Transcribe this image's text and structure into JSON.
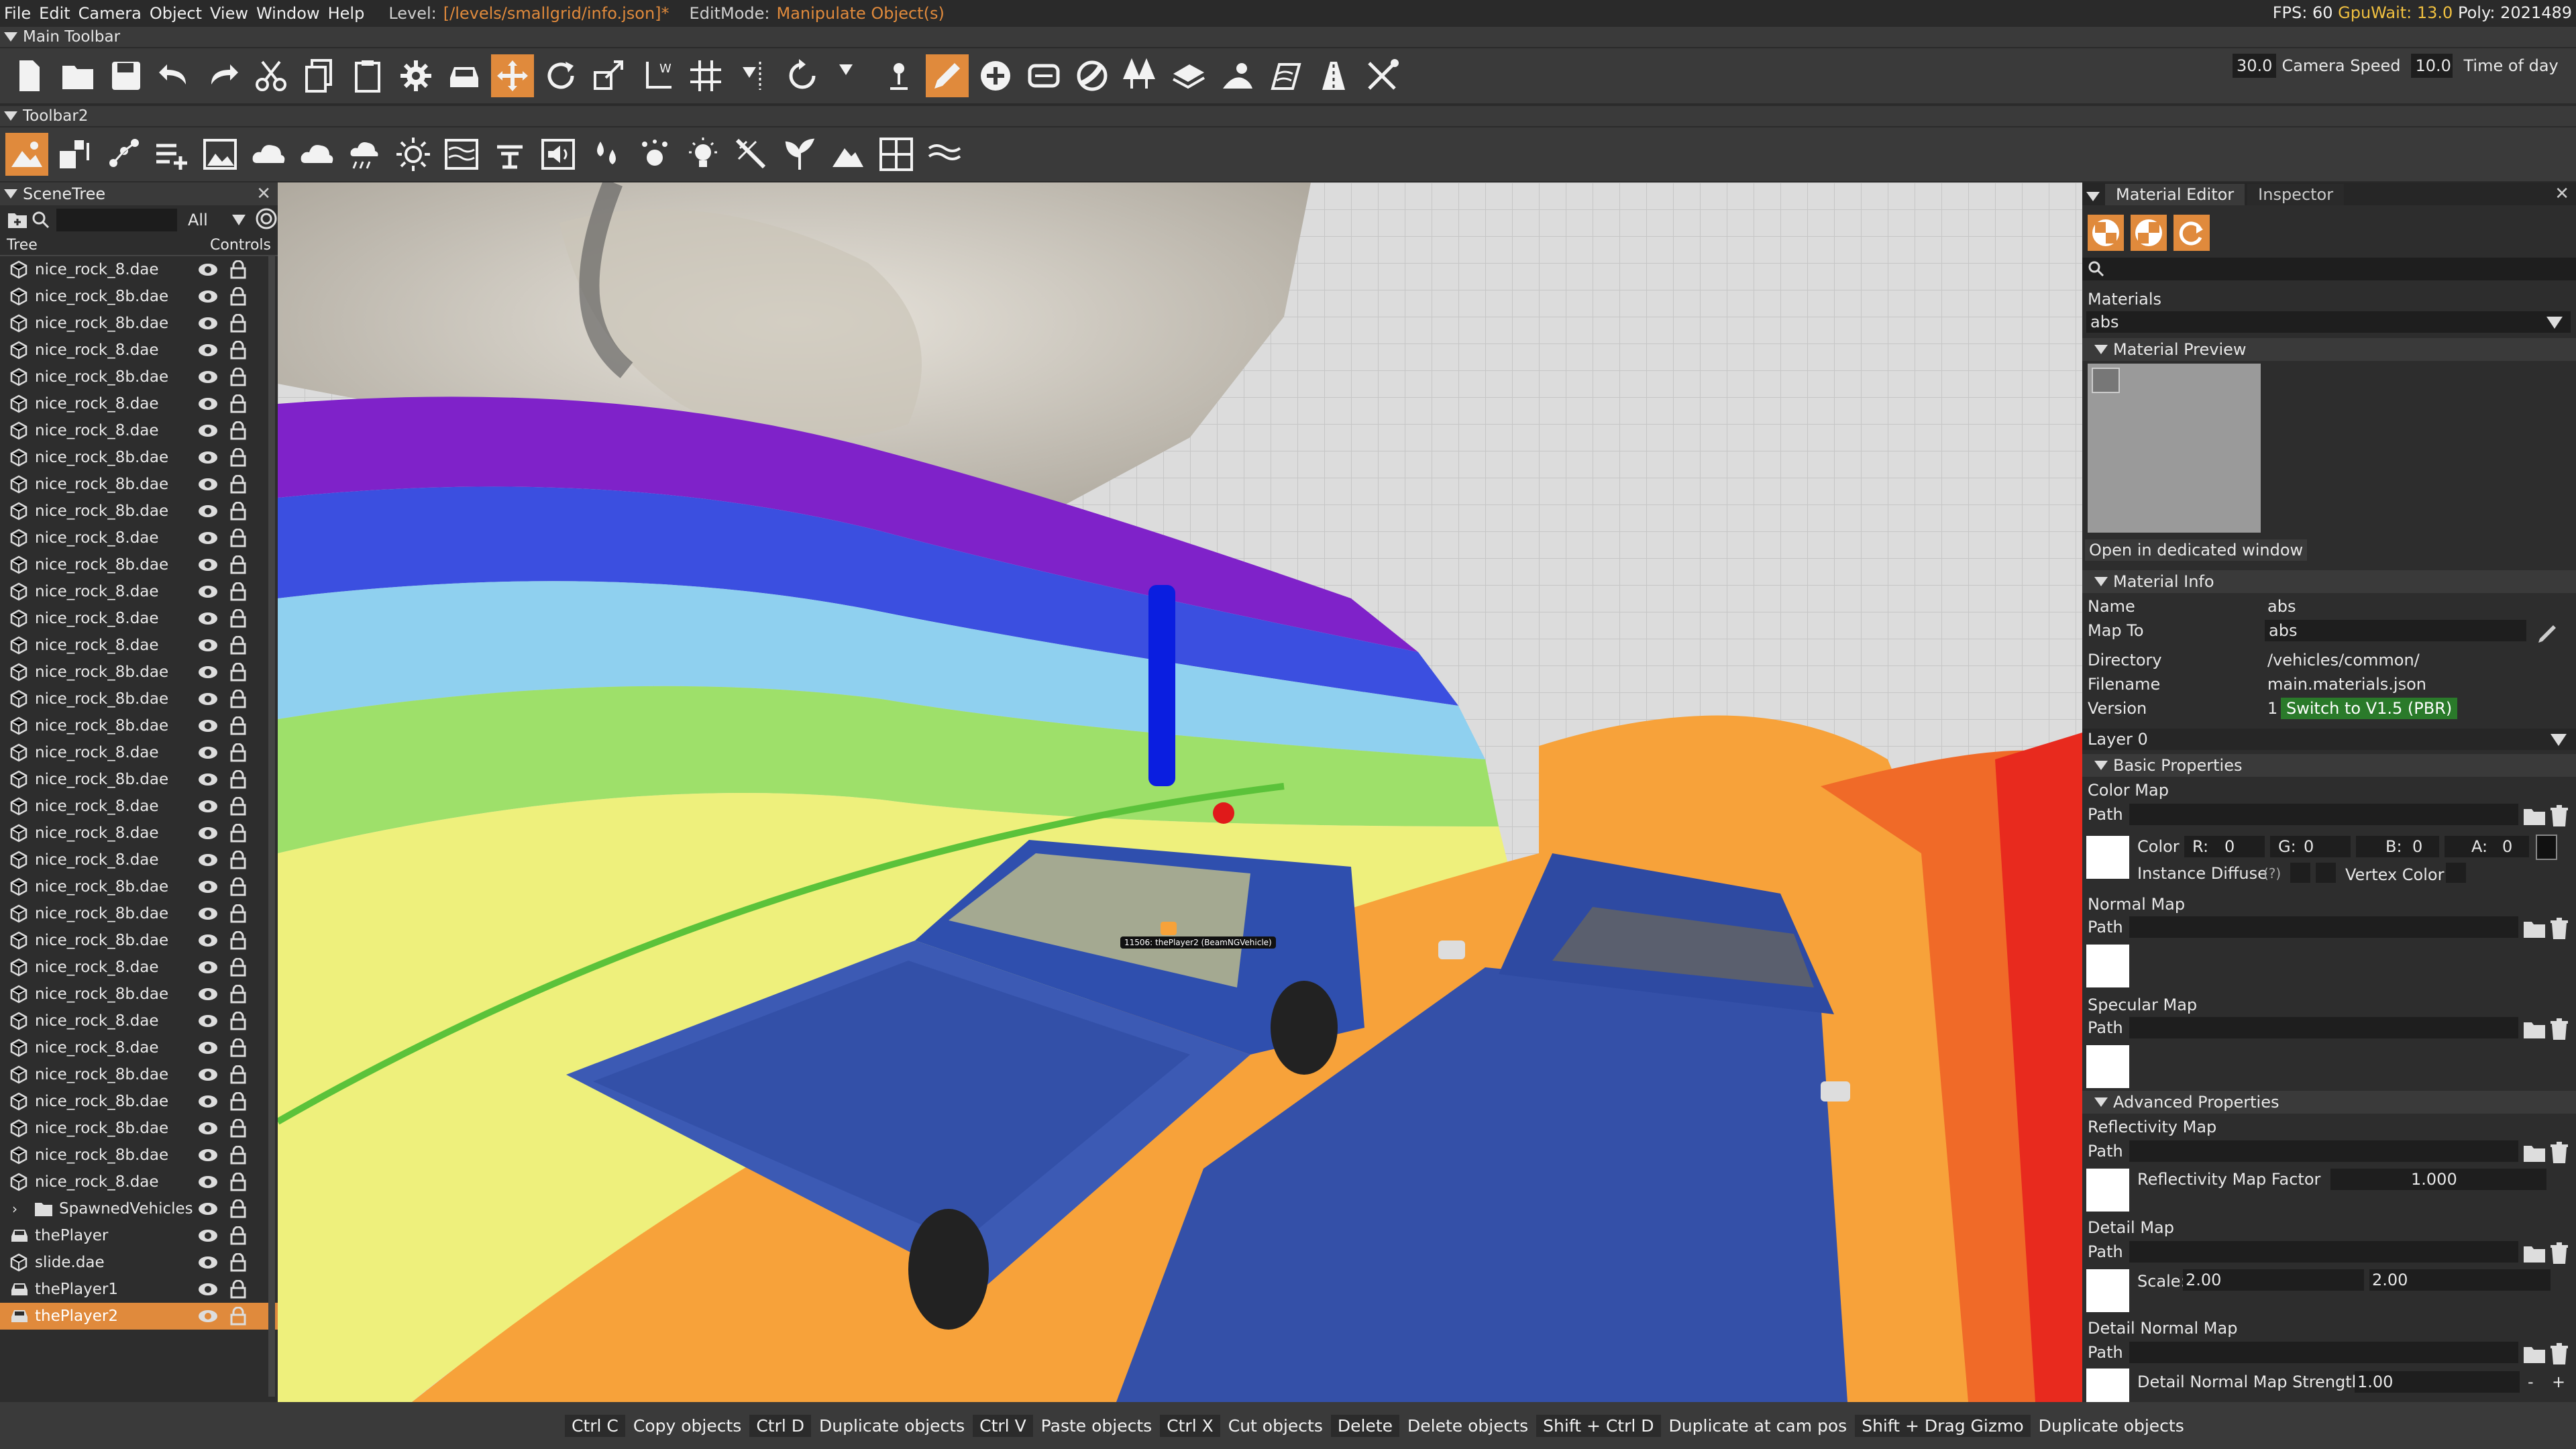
{
  "menubar": {
    "items": [
      "File",
      "Edit",
      "Camera",
      "Object",
      "View",
      "Window",
      "Help"
    ],
    "level_label": "Level:",
    "level_value": "[/levels/smallgrid/info.json]*",
    "editmode_label": "EditMode:",
    "editmode_value": "Manipulate Object(s)",
    "fps_text": "FPS: 60",
    "gpuwait_text": "GpuWait: 13.0",
    "poly_text": "Poly: 2021489"
  },
  "main_toolbar": {
    "title": "Main Toolbar",
    "camera_speed_value": "30.0",
    "camera_speed_label": "Camera Speed",
    "time_of_day_value": "10.0",
    "time_of_day_label": "Time of day"
  },
  "toolbar2": {
    "title": "Toolbar2"
  },
  "scenetree": {
    "title": "SceneTree",
    "filter_value": "All",
    "col_tree": "Tree",
    "col_controls": "Controls",
    "rows": [
      {
        "name": "nice_rock_8.dae",
        "type": "mesh"
      },
      {
        "name": "nice_rock_8b.dae",
        "type": "mesh"
      },
      {
        "name": "nice_rock_8b.dae",
        "type": "mesh"
      },
      {
        "name": "nice_rock_8.dae",
        "type": "mesh"
      },
      {
        "name": "nice_rock_8b.dae",
        "type": "mesh"
      },
      {
        "name": "nice_rock_8.dae",
        "type": "mesh"
      },
      {
        "name": "nice_rock_8.dae",
        "type": "mesh"
      },
      {
        "name": "nice_rock_8b.dae",
        "type": "mesh"
      },
      {
        "name": "nice_rock_8b.dae",
        "type": "mesh"
      },
      {
        "name": "nice_rock_8b.dae",
        "type": "mesh"
      },
      {
        "name": "nice_rock_8.dae",
        "type": "mesh"
      },
      {
        "name": "nice_rock_8b.dae",
        "type": "mesh"
      },
      {
        "name": "nice_rock_8.dae",
        "type": "mesh"
      },
      {
        "name": "nice_rock_8.dae",
        "type": "mesh"
      },
      {
        "name": "nice_rock_8.dae",
        "type": "mesh"
      },
      {
        "name": "nice_rock_8b.dae",
        "type": "mesh"
      },
      {
        "name": "nice_rock_8b.dae",
        "type": "mesh"
      },
      {
        "name": "nice_rock_8b.dae",
        "type": "mesh"
      },
      {
        "name": "nice_rock_8.dae",
        "type": "mesh"
      },
      {
        "name": "nice_rock_8b.dae",
        "type": "mesh"
      },
      {
        "name": "nice_rock_8.dae",
        "type": "mesh"
      },
      {
        "name": "nice_rock_8.dae",
        "type": "mesh"
      },
      {
        "name": "nice_rock_8.dae",
        "type": "mesh"
      },
      {
        "name": "nice_rock_8b.dae",
        "type": "mesh"
      },
      {
        "name": "nice_rock_8b.dae",
        "type": "mesh"
      },
      {
        "name": "nice_rock_8b.dae",
        "type": "mesh"
      },
      {
        "name": "nice_rock_8.dae",
        "type": "mesh"
      },
      {
        "name": "nice_rock_8b.dae",
        "type": "mesh"
      },
      {
        "name": "nice_rock_8.dae",
        "type": "mesh"
      },
      {
        "name": "nice_rock_8.dae",
        "type": "mesh"
      },
      {
        "name": "nice_rock_8b.dae",
        "type": "mesh"
      },
      {
        "name": "nice_rock_8b.dae",
        "type": "mesh"
      },
      {
        "name": "nice_rock_8b.dae",
        "type": "mesh"
      },
      {
        "name": "nice_rock_8b.dae",
        "type": "mesh"
      },
      {
        "name": "nice_rock_8.dae",
        "type": "mesh"
      },
      {
        "name": "SpawnedVehicles",
        "type": "folder"
      },
      {
        "name": "thePlayer",
        "type": "vehicle"
      },
      {
        "name": "slide.dae",
        "type": "mesh"
      },
      {
        "name": "thePlayer1",
        "type": "vehicle"
      },
      {
        "name": "thePlayer2",
        "type": "vehicle",
        "selected": true
      }
    ]
  },
  "viewport": {
    "vehicle_label": "11506: thePlayer2 (BeamNGVehicle)"
  },
  "material_editor": {
    "tab_material": "Material Editor",
    "tab_inspector": "Inspector",
    "materials_label": "Materials",
    "material_selected": "abs",
    "material_preview_header": "Material Preview",
    "open_window_button": "Open in dedicated window",
    "material_info_header": "Material Info",
    "name_label": "Name",
    "name_value": "abs",
    "mapto_label": "Map To",
    "mapto_value": "abs",
    "directory_label": "Directory",
    "directory_value": "/vehicles/common/",
    "filename_label": "Filename",
    "filename_value": "main.materials.json",
    "version_label": "Version",
    "version_value": "1",
    "switch_button": "Switch to V1.5 (PBR)",
    "layer_value": "Layer 0",
    "basic_header": "Basic Properties",
    "color_map_label": "Color Map",
    "path_label": "Path",
    "color_label": "Color",
    "r_label": "R:",
    "r_value": "0",
    "g_label": "G:",
    "g_value": "0",
    "b_label": "B:",
    "b_value": "0",
    "a_label": "A:",
    "a_value": "0",
    "instance_diffuse_label": "Instance Diffuse",
    "instance_diffuse_help": "(?)",
    "vertex_color_label": "Vertex Color",
    "normal_map_label": "Normal Map",
    "specular_map_label": "Specular Map",
    "advanced_header": "Advanced Properties",
    "reflectivity_map_label": "Reflectivity Map",
    "reflectivity_factor_label": "Reflectivity Map Factor",
    "reflectivity_factor_value": "1.000",
    "detail_map_label": "Detail Map",
    "scale_label": "Scale:",
    "scale_x": "2.00",
    "scale_y": "2.00",
    "detail_normal_map_label": "Detail Normal Map",
    "detail_normal_strength_label": "Detail Normal Map Strength",
    "detail_normal_strength_value": "1.00",
    "minus": "-",
    "plus": "+"
  },
  "statusbar": {
    "items": [
      {
        "key": "Ctrl C",
        "action": "Copy objects"
      },
      {
        "key": "Ctrl D",
        "action": "Duplicate objects"
      },
      {
        "key": "Ctrl V",
        "action": "Paste objects"
      },
      {
        "key": "Ctrl X",
        "action": "Cut objects"
      },
      {
        "key": "Delete",
        "action": "Delete objects"
      },
      {
        "key": "Shift + Ctrl D",
        "action": "Duplicate at cam pos"
      },
      {
        "key": "Shift + Drag Gizmo",
        "action": "Duplicate objects"
      }
    ]
  },
  "colors": {
    "accent": "#e08a3c",
    "panel": "#2d2d2d",
    "header": "#3a3a3a",
    "switch_green": "#2a7a2a"
  },
  "icons": {
    "main_toolbar": [
      "new-file-icon",
      "open-folder-icon",
      "save-icon",
      "undo-icon",
      "redo-icon",
      "cut-icon",
      "copy-icon",
      "paste-icon",
      "settings-icon",
      "vehicle-icon",
      "translate-icon",
      "rotate-icon",
      "scale-icon",
      "world-axis-icon",
      "grid-snap-icon",
      "snap-options-icon",
      "rotate-snap-icon",
      "snap-down-icon",
      "drop-to-ground-icon",
      "pencil-icon",
      "add-icon",
      "road-icon",
      "terrain-paint-icon",
      "forest-icon",
      "decal-icon",
      "spawn-icon",
      "river-icon",
      "road-lane-icon",
      "tools-icon"
    ],
    "toolbar2": [
      "landscape-icon",
      "shape-icon",
      "node-icon",
      "list-add-icon",
      "image-icon",
      "cloud-icon",
      "cloud2-icon",
      "weather-icon",
      "sun-icon",
      "water-icon",
      "fountain-icon",
      "sound-icon",
      "drops-icon",
      "particle-icon",
      "light-icon",
      "beam-icon",
      "plant-icon",
      "mountain-icon",
      "grid-icon",
      "waves-icon"
    ]
  }
}
